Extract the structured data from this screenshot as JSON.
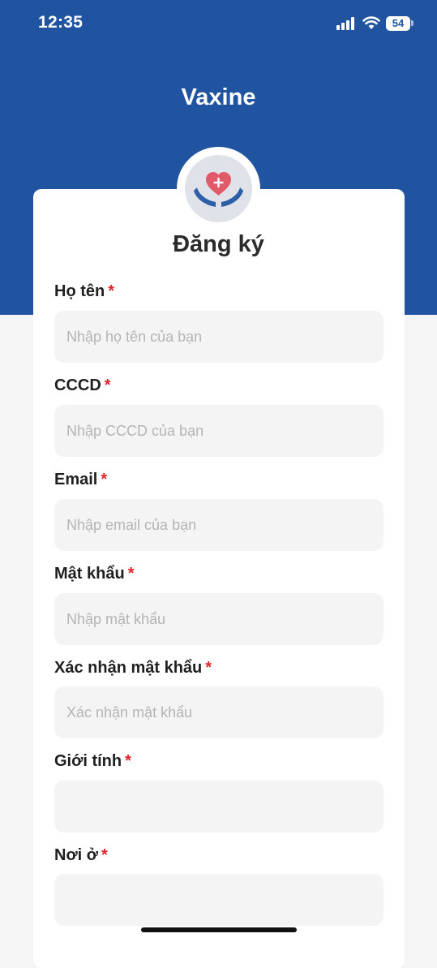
{
  "status": {
    "time": "12:35",
    "battery": "54"
  },
  "app": {
    "title": "Vaxine"
  },
  "form": {
    "title": "Đăng ký",
    "required_mark": "*",
    "fields": [
      {
        "label": "Họ tên",
        "placeholder": "Nhập họ tên của bạn",
        "value": ""
      },
      {
        "label": "CCCD",
        "placeholder": "Nhập CCCD của bạn",
        "value": ""
      },
      {
        "label": "Email",
        "placeholder": "Nhập email của bạn",
        "value": ""
      },
      {
        "label": "Mật khẩu",
        "placeholder": "Nhập mật khẩu",
        "value": ""
      },
      {
        "label": "Xác nhận mật khẩu",
        "placeholder": "Xác nhận mật khẩu",
        "value": ""
      },
      {
        "label": "Giới tính",
        "placeholder": "",
        "value": ""
      },
      {
        "label": "Nơi ở",
        "placeholder": "",
        "value": ""
      }
    ]
  },
  "icons": {
    "logo": "heart-in-hands-icon",
    "signal": "cellular-signal-icon",
    "wifi": "wifi-icon",
    "battery": "battery-icon"
  },
  "colors": {
    "brand": "#2054a0",
    "required": "#e0242b",
    "heart": "#e05a6a",
    "hands": "#2d5fa8"
  }
}
